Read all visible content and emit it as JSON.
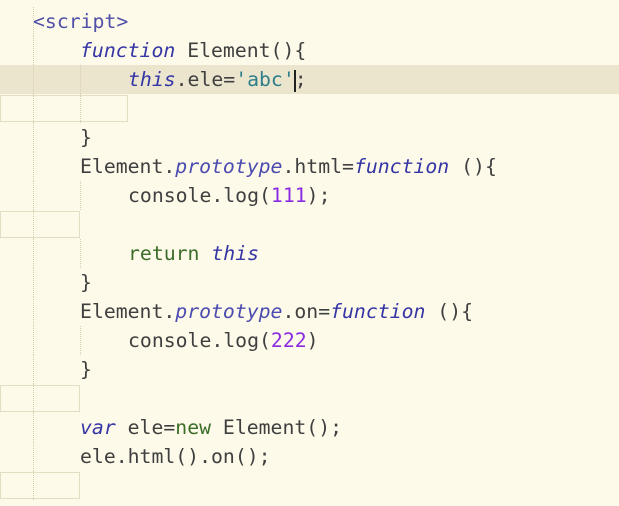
{
  "editor": {
    "lines": [
      {
        "tokens": [
          {
            "t": "<script>",
            "c": "tok-tag"
          }
        ]
      },
      {
        "tokens": [
          {
            "t": "function",
            "c": "tok-kw-it"
          },
          {
            "t": " Element(){",
            "c": "tok-id"
          }
        ]
      },
      {
        "tokens": [
          {
            "t": "this",
            "c": "tok-kw-it"
          },
          {
            "t": ".ele=",
            "c": "tok-id"
          },
          {
            "t": "'abc'",
            "c": "tok-str"
          },
          {
            "t": ";",
            "c": "tok-punct"
          }
        ]
      },
      {
        "tokens": []
      },
      {
        "tokens": [
          {
            "t": "}",
            "c": "tok-punct"
          }
        ]
      },
      {
        "tokens": [
          {
            "t": "Element.",
            "c": "tok-id"
          },
          {
            "t": "prototype",
            "c": "tok-prop"
          },
          {
            "t": ".html=",
            "c": "tok-id"
          },
          {
            "t": "function",
            "c": "tok-kw-it"
          },
          {
            "t": " (){",
            "c": "tok-id"
          }
        ]
      },
      {
        "tokens": [
          {
            "t": "console.log(",
            "c": "tok-id"
          },
          {
            "t": "111",
            "c": "tok-num"
          },
          {
            "t": ");",
            "c": "tok-id"
          }
        ]
      },
      {
        "tokens": []
      },
      {
        "tokens": [
          {
            "t": "return ",
            "c": "tok-kw-green"
          },
          {
            "t": "this",
            "c": "tok-kw-it"
          }
        ]
      },
      {
        "tokens": [
          {
            "t": "}",
            "c": "tok-punct"
          }
        ]
      },
      {
        "tokens": [
          {
            "t": "Element.",
            "c": "tok-id"
          },
          {
            "t": "prototype",
            "c": "tok-prop"
          },
          {
            "t": ".on=",
            "c": "tok-id"
          },
          {
            "t": "function",
            "c": "tok-kw-it"
          },
          {
            "t": " (){",
            "c": "tok-id"
          }
        ]
      },
      {
        "tokens": [
          {
            "t": "console.log(",
            "c": "tok-id"
          },
          {
            "t": "222",
            "c": "tok-num"
          },
          {
            "t": ")",
            "c": "tok-id"
          }
        ]
      },
      {
        "tokens": [
          {
            "t": "}",
            "c": "tok-punct"
          }
        ]
      },
      {
        "tokens": []
      },
      {
        "tokens": [
          {
            "t": "var",
            "c": "tok-kw-it"
          },
          {
            "t": " ele=",
            "c": "tok-id"
          },
          {
            "t": "new",
            "c": "tok-kw-green"
          },
          {
            "t": " Element();",
            "c": "tok-id"
          }
        ]
      },
      {
        "tokens": [
          {
            "t": "ele.html().on();",
            "c": "tok-id"
          }
        ]
      },
      {
        "tokens": []
      }
    ],
    "colors": {
      "background": "#fdfae9",
      "current_line": "#ebe5ce",
      "keyword": "#3535a5",
      "string": "#2e7d8a",
      "number": "#8a2be2",
      "text": "#3f3f3f"
    }
  }
}
